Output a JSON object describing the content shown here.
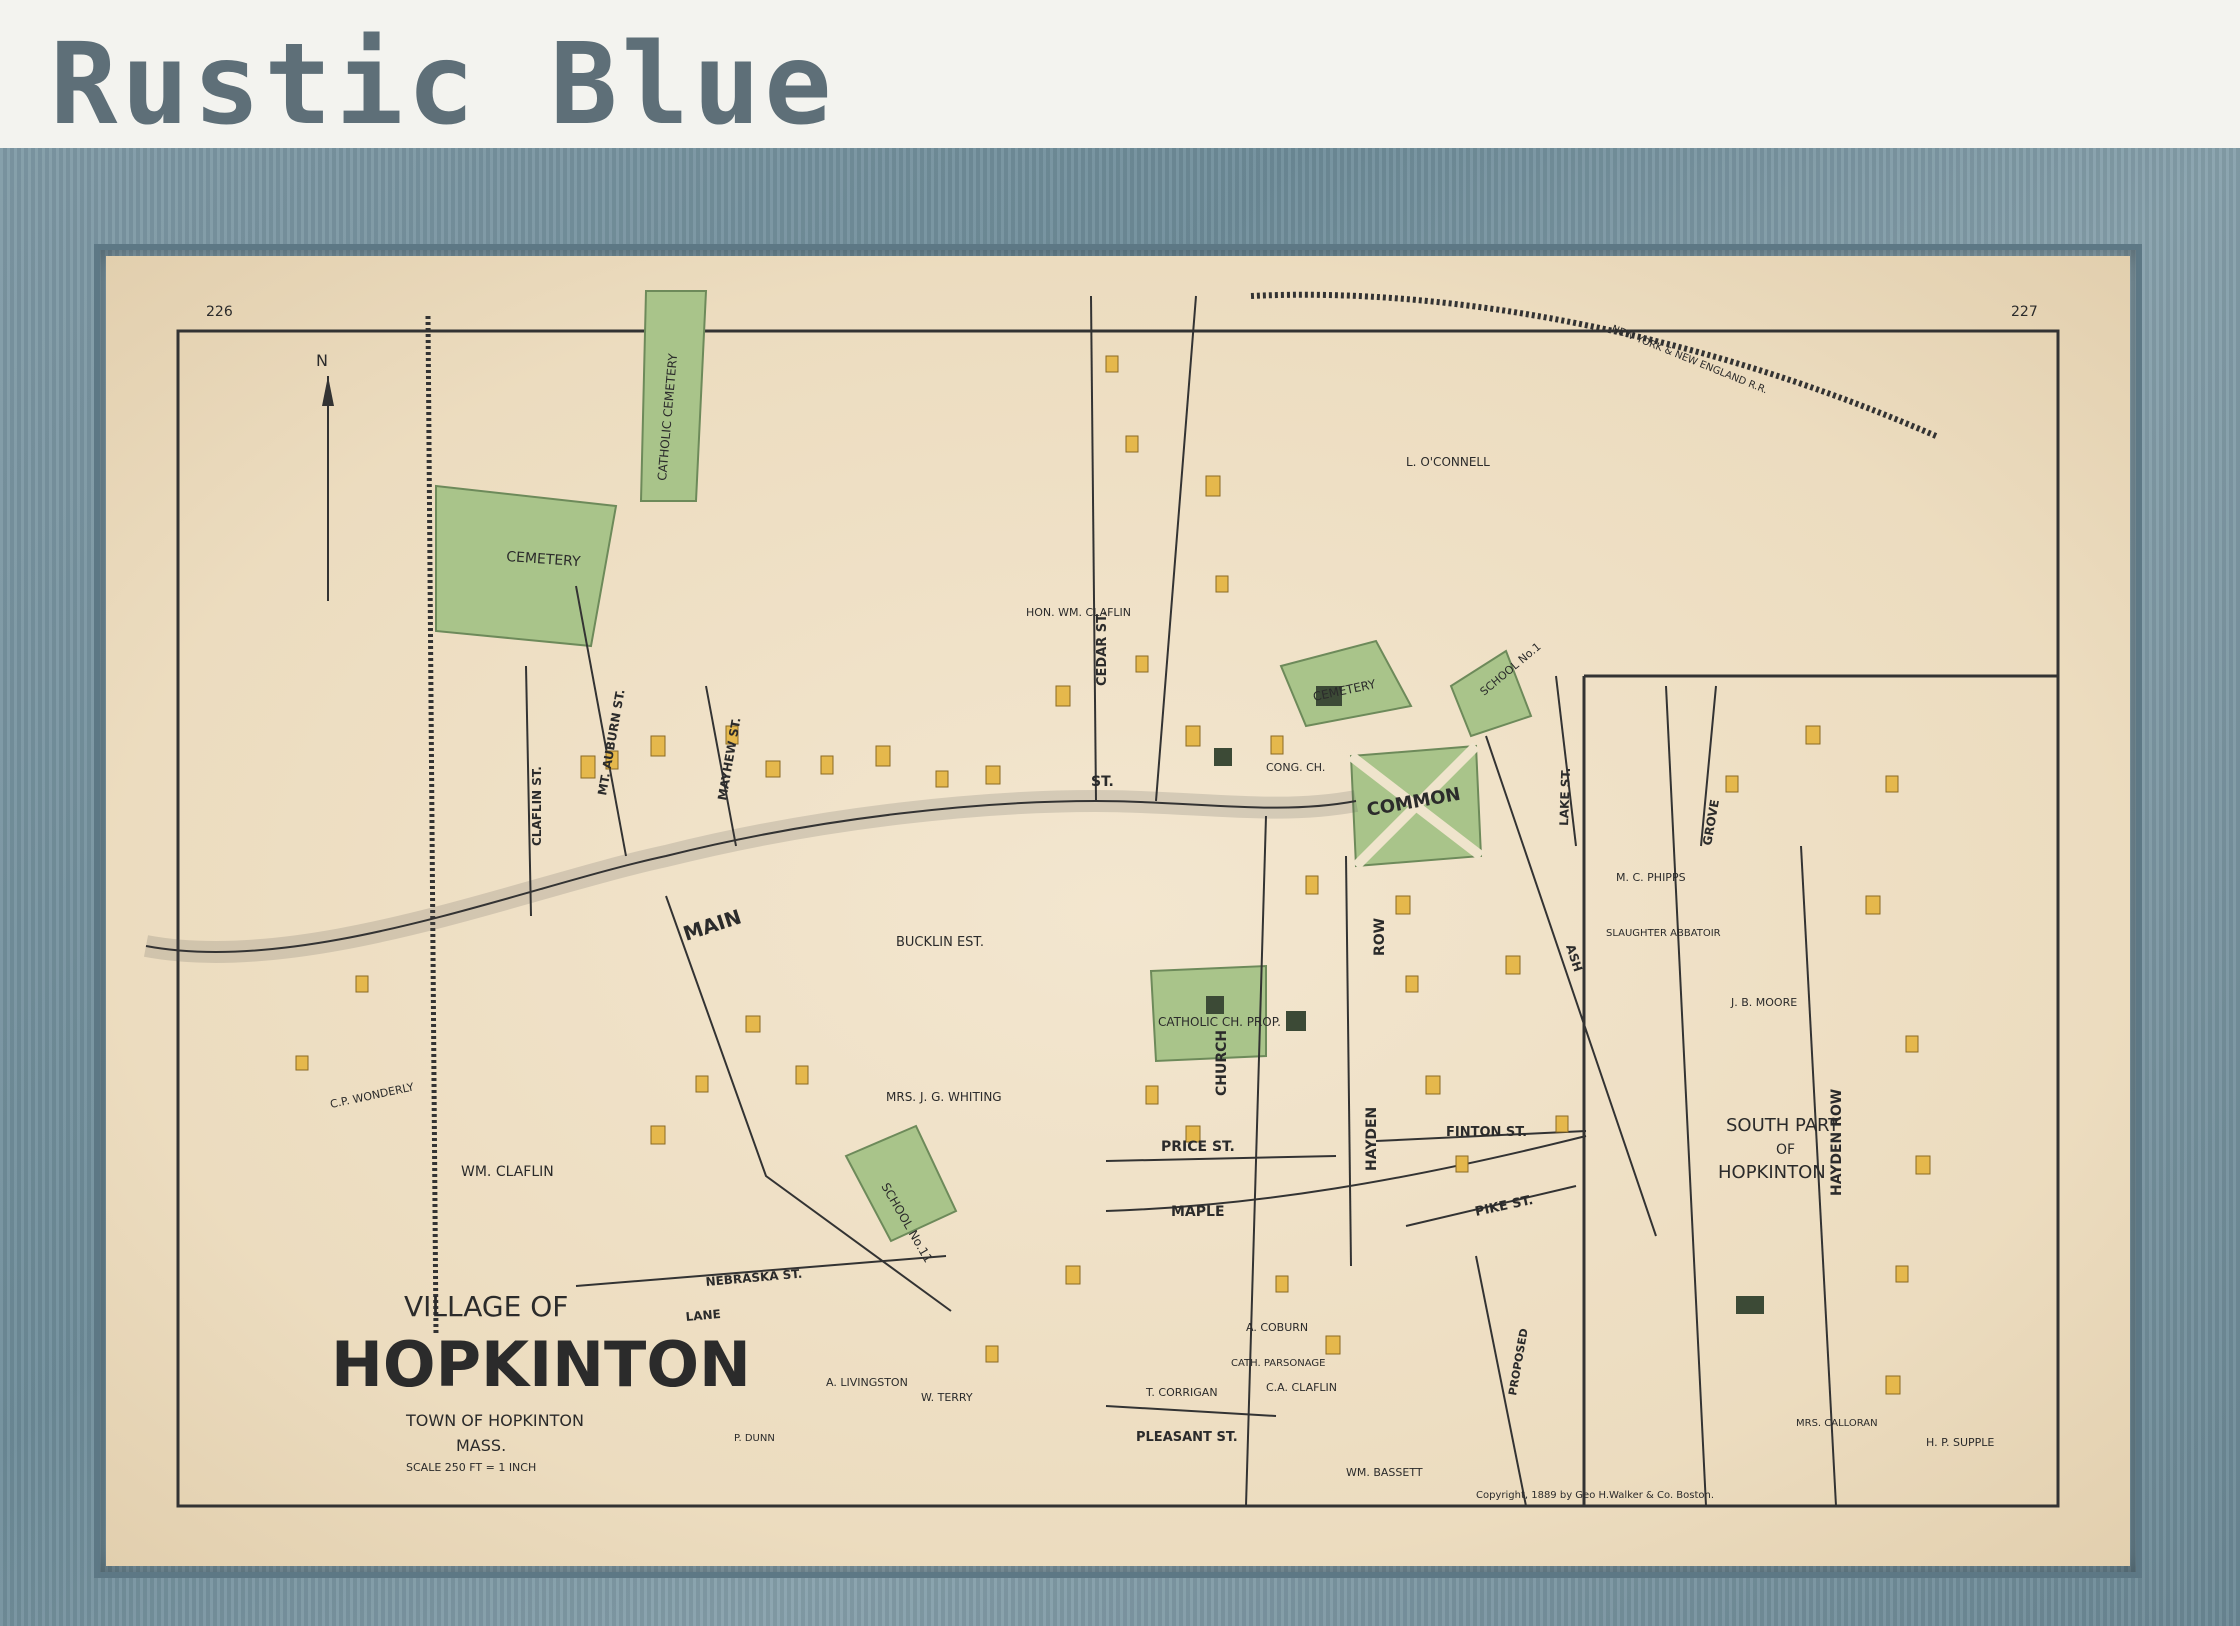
{
  "title": "Rustic Blue",
  "map": {
    "page_left": "226",
    "page_right": "227",
    "village_of": "VILLAGE OF",
    "town_name": "HOPKINTON",
    "town_of": "TOWN OF HOPKINTON",
    "state": "MASS.",
    "scale": "SCALE 250 FT = 1 INCH",
    "south_part": "SOUTH PART",
    "south_of": "OF",
    "south_name": "HOPKINTON",
    "copyright": "Copyright, 1889 by Geo H.Walker & Co. Boston.",
    "railroad": "NEW YORK & NEW ENGLAND R.R.",
    "labels": {
      "cemetery": "CEMETERY",
      "catholic_cemetery": "CATHOLIC CEMETERY",
      "cemetery2": "CEMETERY",
      "common": "COMMON",
      "school1": "SCHOOL No.1",
      "school2": "SCHOOL No.11",
      "catholic_prop": "CATHOLIC CH. PROP.",
      "buckling": "BUCKLIN EST.",
      "whiting": "MRS. J. G. WHITING",
      "claflin": "WM. CLAFLIN",
      "main_st": "MAIN",
      "st": "ST.",
      "hayden_row": "HAYDEN ROW",
      "hayden": "HAYDEN",
      "row": "ROW",
      "church_st": "CHURCH",
      "price_st": "PRICE ST.",
      "maple_st": "MAPLE",
      "pleasant_st": "PLEASANT ST.",
      "pike_st": "PIKE ST.",
      "finton_st": "FINTON ST.",
      "cedar_st": "CEDAR ST.",
      "grove_st": "GROVE",
      "lake_st": "LAKE ST.",
      "claflin_st": "CLAFLIN ST.",
      "mt_auburn": "MT. AUBURN ST.",
      "mayhew": "MAYHEW ST.",
      "nebraska": "NEBRASKA ST.",
      "lane": "LANE",
      "proposed": "PROPOSED",
      "ash": "ASH",
      "l_oconnell": "L. O'CONNELL",
      "hon_claflin": "HON. WM. CLAFLIN",
      "conge_ch": "CONG. CH.",
      "t_corrigan": "T. CORRIGAN",
      "mc_phipps": "M. C. PHIPPS",
      "jb_moore": "J. B. MOORE",
      "wm_bassett": "WM. BASSETT",
      "ca_claflin": "C.A. CLAFLIN",
      "a_coburn": "A. COBURN",
      "cath_parsonage": "CATH. PARSONAGE",
      "a_livingston": "A. LIVINGSTON",
      "w_terry": "W. TERRY",
      "p_dunn": "P. DUNN",
      "cp_wonderly": "C.P. WONDERLY",
      "slaughter": "SLAUGHTER ABBATOIR",
      "hp_supple": "H. P. SUPPLE",
      "mrs_calloran": "MRS. CALLORAN",
      "n": "N"
    }
  }
}
